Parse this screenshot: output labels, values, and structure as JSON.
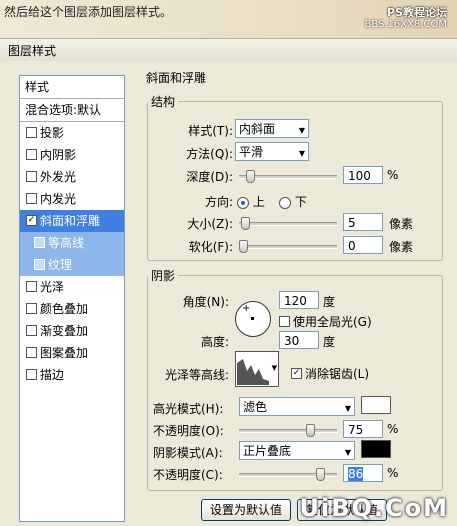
{
  "caption": "然后给这个图层添加图层样式。",
  "watermark_top": "PS教程论坛",
  "watermark_url": "BBS.16XX8.COM",
  "dialog_title": "图层样式",
  "styles_panel": {
    "header": "样式",
    "blend_options": "混合选项:默认",
    "items": [
      {
        "label": "投影",
        "checked": false
      },
      {
        "label": "内阴影",
        "checked": false
      },
      {
        "label": "外发光",
        "checked": false
      },
      {
        "label": "内发光",
        "checked": false
      },
      {
        "label": "斜面和浮雕",
        "checked": true
      },
      {
        "label": "等高线",
        "checked": false
      },
      {
        "label": "纹理",
        "checked": false
      },
      {
        "label": "光泽",
        "checked": false
      },
      {
        "label": "颜色叠加",
        "checked": false
      },
      {
        "label": "渐变叠加",
        "checked": false
      },
      {
        "label": "图案叠加",
        "checked": false
      },
      {
        "label": "描边",
        "checked": false
      }
    ]
  },
  "bevel": {
    "group_title": "斜面和浮雕",
    "structure_title": "结构",
    "style_label": "样式(T):",
    "style_value": "内斜面",
    "technique_label": "方法(Q):",
    "technique_value": "平滑",
    "depth_label": "深度(D):",
    "depth_value": "100",
    "depth_unit": "%",
    "depth_slider": 0.08,
    "direction_label": "方向:",
    "dir_up": "上",
    "dir_down": "下",
    "size_label": "大小(Z):",
    "size_value": "5",
    "size_unit": "像素",
    "size_slider": 0.02,
    "soften_label": "软化(F):",
    "soften_value": "0",
    "soften_unit": "像素",
    "soften_slider": 0.0
  },
  "shading": {
    "title": "阴影",
    "angle_label": "角度(N):",
    "angle_value": "120",
    "angle_unit": "度",
    "global_light_label": "使用全局光(G)",
    "altitude_label": "高度:",
    "altitude_value": "30",
    "altitude_unit": "度",
    "gloss_label": "光泽等高线:",
    "antialias_label": "消除锯齿(L)",
    "highlight_mode_label": "高光模式(H):",
    "highlight_mode_value": "滤色",
    "highlight_color": "#ffffff",
    "hl_opacity_label": "不透明度(O):",
    "hl_opacity_value": "75",
    "hl_opacity_unit": "%",
    "hl_opacity_slider": 0.75,
    "shadow_mode_label": "阴影模式(A):",
    "shadow_mode_value": "正片叠底",
    "shadow_color": "#000000",
    "sh_opacity_label": "不透明度(C):",
    "sh_opacity_value": "86",
    "sh_opacity_unit": "%",
    "sh_opacity_slider": 0.86
  },
  "buttons": {
    "make_default": "设置为默认值",
    "reset_default": "复位为默认值"
  },
  "site_watermark": "UiBQ.CoM"
}
